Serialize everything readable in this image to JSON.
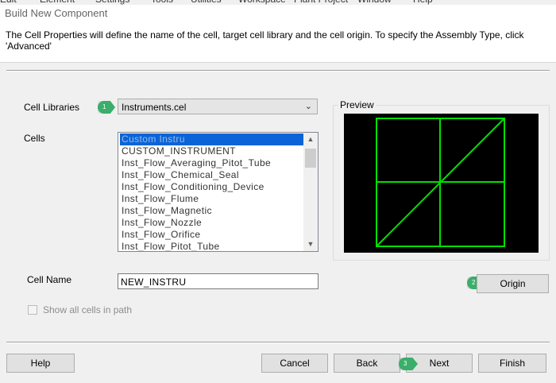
{
  "dialog": {
    "title": "Build New Component",
    "description": "The Cell Properties will define the name of the cell, target cell library and the cell origin.  To specify the Assembly Type, click 'Advanced'"
  },
  "cell_libraries": {
    "label": "Cell Libraries",
    "selected": "Instruments.cel",
    "callout": "1"
  },
  "cells": {
    "label": "Cells",
    "items": [
      "Custom Instru",
      "CUSTOM_INSTRUMENT",
      "Inst_Flow_Averaging_Pitot_Tube",
      "Inst_Flow_Chemical_Seal",
      "Inst_Flow_Conditioning_Device",
      "Inst_Flow_Flume",
      "Inst_Flow_Magnetic",
      "Inst_Flow_Nozzle",
      "Inst_Flow_Orifice",
      "Inst_Flow_Pitot_Tube"
    ],
    "selected_index": 0
  },
  "preview": {
    "label": "Preview",
    "line_color": "#00e000",
    "background": "#000000"
  },
  "cell_name": {
    "label": "Cell Name",
    "value": "NEW_INSTRU"
  },
  "show_all_cells": {
    "label": "Show all cells in path",
    "checked": false
  },
  "buttons": {
    "origin": "Origin",
    "origin_callout": "2",
    "help": "Help",
    "cancel": "Cancel",
    "back": "Back",
    "next": "Next",
    "next_callout": "3",
    "finish": "Finish"
  },
  "colors": {
    "callout": "#3aae6a",
    "selection": "#0a64d8"
  }
}
